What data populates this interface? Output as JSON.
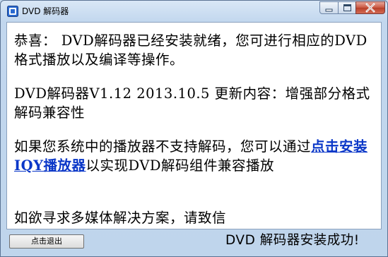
{
  "window": {
    "title": "DVD 解码器",
    "controls": {
      "minimize": "minimize-icon",
      "maximize": "maximize-icon",
      "close": "close-icon"
    }
  },
  "content": {
    "p1": "恭喜： DVD解码器已经安装就绪，您可进行相应的DVD格式播放以及编译等操作。",
    "p2": "DVD解码器V1.12 2013.10.5 更新内容：增强部分格式解码兼容性",
    "p3_before": "如果您系统中的播放器不支持解码，您可以通过",
    "p3_link": "点击安装IQY播放器",
    "p3_after": "以实现DVD解码组件兼容播放",
    "p4": "如欲寻求多媒体解决方案，请致信"
  },
  "footer": {
    "exit_label": "点击退出",
    "status": "DVD 解码器安装成功!"
  },
  "colors": {
    "link": "#0a37c8",
    "frame": "#c2d7ee",
    "close_button": "#c8553f"
  }
}
